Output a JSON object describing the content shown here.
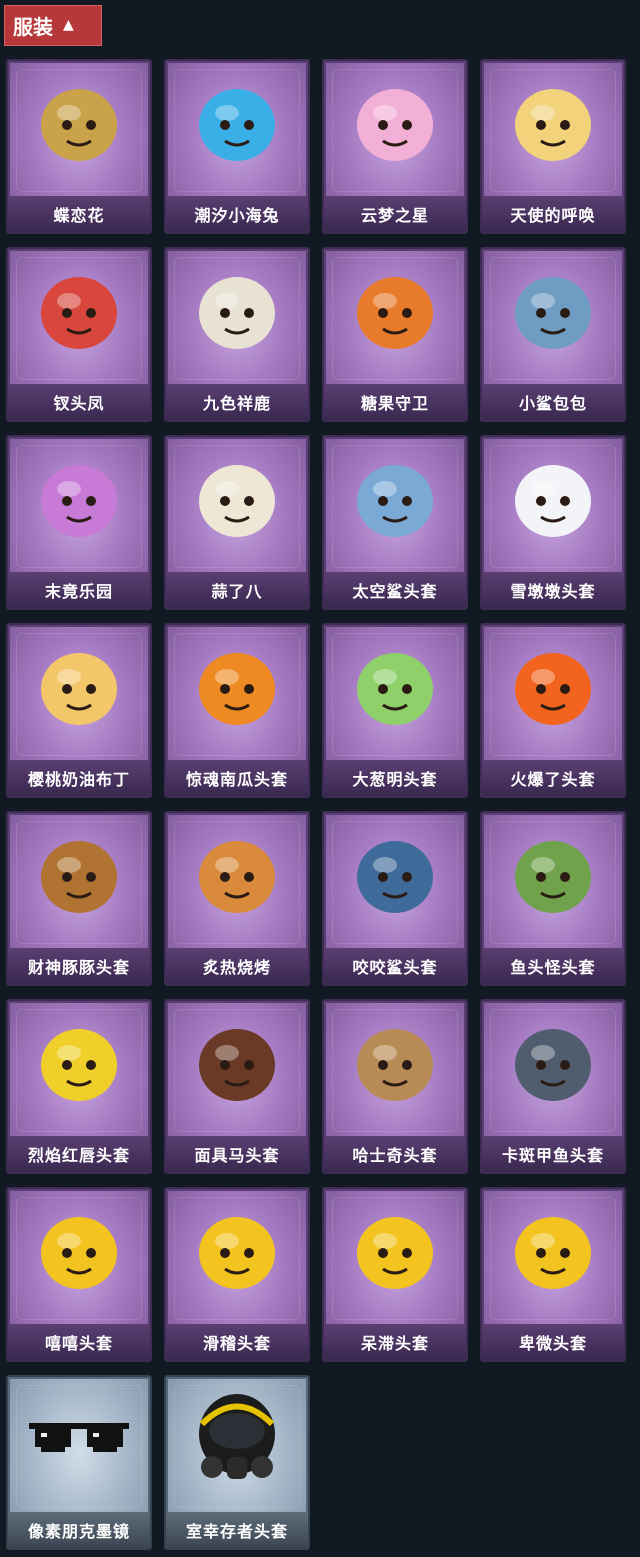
{
  "header": {
    "title": "服装",
    "toggle_icon": "chevron-up-icon"
  },
  "items": [
    {
      "name": "蝶恋花",
      "icon": "butterfly-flower-crown-icon",
      "color": "#c9a24a",
      "frame": "purple"
    },
    {
      "name": "潮汐小海兔",
      "icon": "blue-sea-bunny-icon",
      "color": "#3aaee6",
      "frame": "purple"
    },
    {
      "name": "云梦之星",
      "icon": "unicorn-cloud-icon",
      "color": "#f3b0d6",
      "frame": "purple"
    },
    {
      "name": "天使的呼唤",
      "icon": "angel-doll-icon",
      "color": "#f2d27a",
      "frame": "purple"
    },
    {
      "name": "钗头凤",
      "icon": "phoenix-crown-doll-icon",
      "color": "#d9463e",
      "frame": "purple"
    },
    {
      "name": "九色祥鹿",
      "icon": "white-deer-icon",
      "color": "#e8e2d3",
      "frame": "purple"
    },
    {
      "name": "糖果守卫",
      "icon": "candy-scarecrow-icon",
      "color": "#e87a2b",
      "frame": "purple"
    },
    {
      "name": "小鲨包包",
      "icon": "shark-bag-icon",
      "color": "#6f9cc3",
      "frame": "purple"
    },
    {
      "name": "末竟乐园",
      "icon": "pink-hair-doll-icon",
      "color": "#c77ad6",
      "frame": "purple"
    },
    {
      "name": "蒜了八",
      "icon": "garlic-head-icon",
      "color": "#efe7d6",
      "frame": "purple"
    },
    {
      "name": "太空鲨头套",
      "icon": "space-shark-helmet-icon",
      "color": "#7aa9d6",
      "frame": "purple"
    },
    {
      "name": "雪墩墩头套",
      "icon": "snowman-helmet-icon",
      "color": "#f2f4f8",
      "frame": "purple"
    },
    {
      "name": "樱桃奶油布丁",
      "icon": "pudding-helmet-icon",
      "color": "#f4c66a",
      "frame": "purple"
    },
    {
      "name": "惊魂南瓜头套",
      "icon": "pumpkin-helmet-icon",
      "color": "#ef8a22",
      "frame": "purple"
    },
    {
      "name": "大葱明头套",
      "icon": "scallion-helmet-icon",
      "color": "#8fd06a",
      "frame": "purple"
    },
    {
      "name": "火爆了头套",
      "icon": "fire-helmet-icon",
      "color": "#f2641e",
      "frame": "purple"
    },
    {
      "name": "财神豚豚头套",
      "icon": "capybara-helmet-icon",
      "color": "#b07332",
      "frame": "purple"
    },
    {
      "name": "炙热烧烤",
      "icon": "bbq-meat-helmet-icon",
      "color": "#d98a3a",
      "frame": "purple"
    },
    {
      "name": "咬咬鲨头套",
      "icon": "biting-shark-helmet-icon",
      "color": "#3f6b9a",
      "frame": "purple"
    },
    {
      "name": "鱼头怪头套",
      "icon": "fish-head-mask-icon",
      "color": "#6fa24a",
      "frame": "purple"
    },
    {
      "name": "烈焰红唇头套",
      "icon": "yellow-mouse-mask-icon",
      "color": "#f0cf2a",
      "frame": "purple"
    },
    {
      "name": "面具马头套",
      "icon": "horse-mask-icon",
      "color": "#6a3a26",
      "frame": "purple"
    },
    {
      "name": "哈士奇头套",
      "icon": "husky-mask-icon",
      "color": "#b88a55",
      "frame": "purple"
    },
    {
      "name": "卡斑甲鱼头套",
      "icon": "fish-helmet-icon",
      "color": "#4f5d6e",
      "frame": "purple"
    },
    {
      "name": "嘻嘻头套",
      "icon": "grin-emoji-helmet-icon",
      "color": "#f3c41f",
      "frame": "purple"
    },
    {
      "name": "滑稽头套",
      "icon": "smirk-emoji-helmet-icon",
      "color": "#f3c41f",
      "frame": "purple"
    },
    {
      "name": "呆滞头套",
      "icon": "dazed-emoji-helmet-icon",
      "color": "#f3c41f",
      "frame": "purple"
    },
    {
      "name": "卑微头套",
      "icon": "humble-emoji-helmet-icon",
      "color": "#f3c41f",
      "frame": "purple"
    },
    {
      "name": "像素朋克墨镜",
      "icon": "pixel-sunglasses-icon",
      "color": "#111111",
      "frame": "blue"
    },
    {
      "name": "室幸存者头套",
      "icon": "gas-mask-helmet-icon",
      "color": "#222222",
      "frame": "blue"
    }
  ]
}
